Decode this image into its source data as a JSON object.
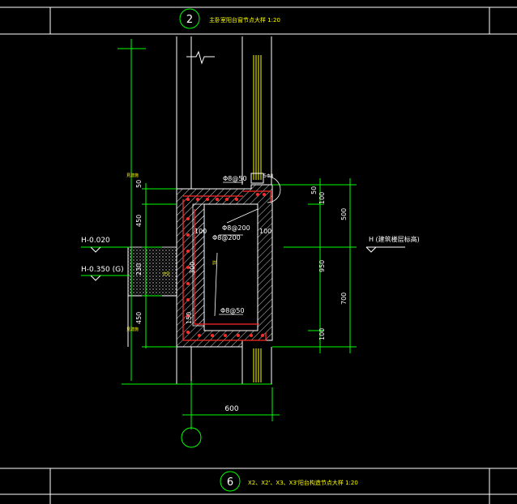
{
  "title_block_top": {
    "number": "2",
    "title": "主卧室阳台窗节点大样 1:20"
  },
  "title_block_bottom": {
    "number": "6",
    "title": "X2、X2'、X3、X3'阳台构造节点大样 1:20"
  },
  "elevations": {
    "h1": "H-0.020",
    "h2": "H-0.350 (G)",
    "h3": "H (建筑楼层标高)"
  },
  "left_dims": [
    "50",
    "450",
    "230",
    "450"
  ],
  "left_labels": {
    "top": "見建施",
    "bottom": "見建施",
    "mid": "详见"
  },
  "inner_dims": {
    "top_left": "100",
    "top_right": "100",
    "thickness": "300",
    "bottom_left": "150",
    "bottom_dim": "600"
  },
  "rebar_labels": {
    "top": "Φ8@50",
    "mid1": "Φ8@200",
    "mid2": "Φ8@200",
    "bottom": "Φ8@50",
    "side": "5Φ8"
  },
  "right_dims_outer": [
    "500",
    "700"
  ],
  "right_dims_inner": [
    "50",
    "100",
    "950",
    "100"
  ],
  "notes": {
    "small1": "詳",
    "small2": "5Φ8"
  },
  "colors": {
    "green": "#00ff00",
    "red": "#ff2a2a",
    "white": "#ffffff",
    "yellow": "#ffff00",
    "cyan": "#00ffff"
  }
}
